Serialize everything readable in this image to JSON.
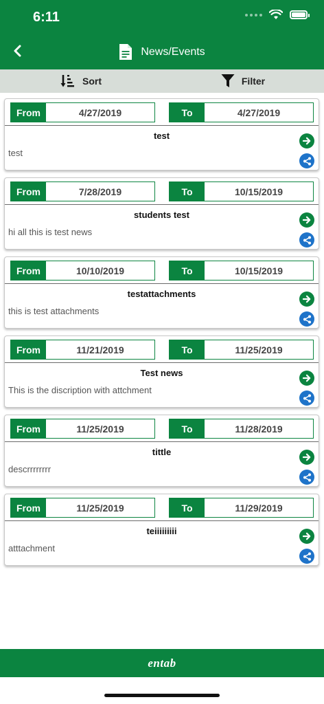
{
  "status": {
    "time": "6:11"
  },
  "header": {
    "title": "News/Events"
  },
  "toolbar": {
    "sort_label": "Sort",
    "filter_label": "Filter"
  },
  "labels": {
    "from": "From",
    "to": "To"
  },
  "items": [
    {
      "from": "4/27/2019",
      "to": "4/27/2019",
      "title": "test",
      "desc": "test"
    },
    {
      "from": "7/28/2019",
      "to": "10/15/2019",
      "title": "students test",
      "desc": "hi all this is test news"
    },
    {
      "from": "10/10/2019",
      "to": "10/15/2019",
      "title": "testattachments",
      "desc": "this is test attachments"
    },
    {
      "from": "11/21/2019",
      "to": "11/25/2019",
      "title": "Test news",
      "desc": "This is the discription with attchment"
    },
    {
      "from": "11/25/2019",
      "to": "11/28/2019",
      "title": "tittle",
      "desc": "descrrrrrrrr"
    },
    {
      "from": "11/25/2019",
      "to": "11/29/2019",
      "title": "teiiiiiiiii",
      "desc": "atttachment"
    }
  ],
  "footer": {
    "brand": "entab"
  },
  "colors": {
    "primary": "#0b8440",
    "share": "#1e73c9",
    "toolbar_bg": "#d7ddd8"
  },
  "icons": {
    "back": "chevron-left-icon",
    "document": "document-icon",
    "sort": "sort-icon",
    "filter": "filter-icon",
    "open": "arrow-right-icon",
    "share": "share-icon"
  }
}
